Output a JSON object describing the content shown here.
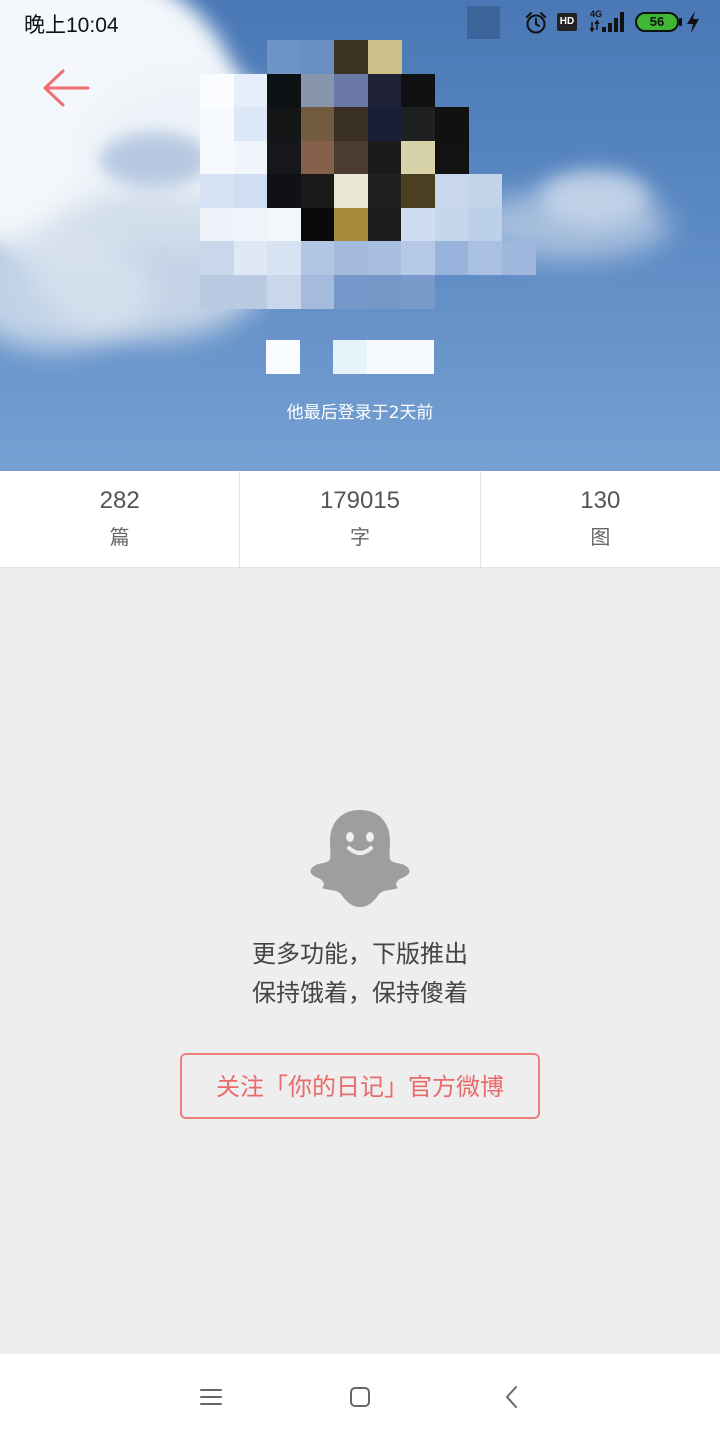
{
  "status_bar": {
    "time": "晚上10:04",
    "network": "4G",
    "hd": "HD",
    "battery_level": "56",
    "icons": [
      "alarm-icon",
      "hd-icon",
      "signal-icon",
      "battery-icon",
      "charging-icon"
    ]
  },
  "header": {
    "back_icon": "arrow-left-icon",
    "last_login": "他最后登录于2天前",
    "accent_color": "#ee6f6f"
  },
  "stats": [
    {
      "value": "282",
      "label": "篇"
    },
    {
      "value": "179015",
      "label": "字"
    },
    {
      "value": "130",
      "label": "图"
    }
  ],
  "empty_state": {
    "icon": "ghost-icon",
    "line1": "更多功能，下版推出",
    "line2": "保持饿着，保持傻着",
    "follow_button": "关注「你的日记」官方微博"
  },
  "nav_bar": {
    "icons": [
      "menu-icon",
      "home-icon",
      "back-icon"
    ]
  }
}
